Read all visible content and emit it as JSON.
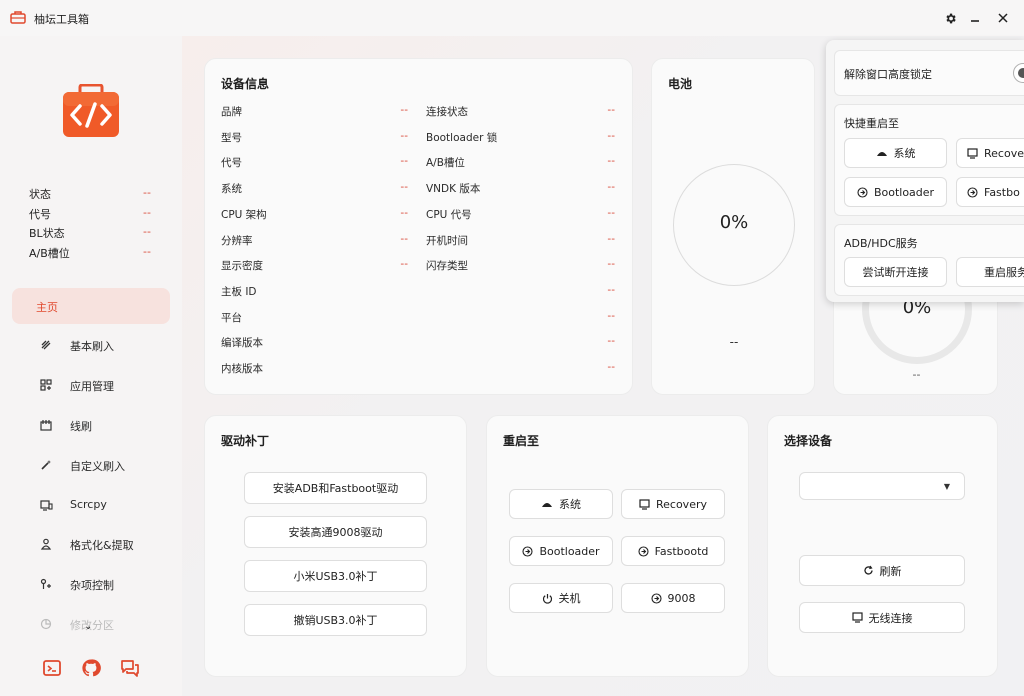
{
  "window": {
    "title": "柚坛工具箱",
    "accent": "#e0492e"
  },
  "sidebar": {
    "status": [
      {
        "label": "状态",
        "value": "--"
      },
      {
        "label": "代号",
        "value": "--"
      },
      {
        "label": "BL状态",
        "value": "--"
      },
      {
        "label": "A/B槽位",
        "value": "--"
      }
    ],
    "nav": [
      {
        "label": "主页",
        "icon": "home-icon"
      },
      {
        "label": "基本刷入",
        "icon": "flash-icon"
      },
      {
        "label": "应用管理",
        "icon": "apps-icon"
      },
      {
        "label": "线刷",
        "icon": "line-flash-icon"
      },
      {
        "label": "自定义刷入",
        "icon": "wand-icon"
      },
      {
        "label": "Scrcpy",
        "icon": "screen-mirror-icon"
      },
      {
        "label": "格式化&提取",
        "icon": "format-icon"
      },
      {
        "label": "杂项控制",
        "icon": "misc-control-icon"
      },
      {
        "label": "修改分区",
        "icon": "partition-icon"
      }
    ]
  },
  "device_info": {
    "title": "设备信息",
    "left": [
      {
        "label": "品牌",
        "value": "--"
      },
      {
        "label": "型号",
        "value": "--"
      },
      {
        "label": "代号",
        "value": "--"
      },
      {
        "label": "系统",
        "value": "--"
      },
      {
        "label": "CPU 架构",
        "value": "--"
      },
      {
        "label": "分辨率",
        "value": "--"
      },
      {
        "label": "显示密度",
        "value": "--"
      },
      {
        "label": "主板 ID",
        "value": "--"
      },
      {
        "label": "平台",
        "value": "--"
      },
      {
        "label": "编译版本",
        "value": "--"
      },
      {
        "label": "内核版本",
        "value": "--"
      }
    ],
    "right": [
      {
        "label": "连接状态",
        "value": "--"
      },
      {
        "label": "Bootloader 锁",
        "value": "--"
      },
      {
        "label": "A/B槽位",
        "value": "--"
      },
      {
        "label": "VNDK 版本",
        "value": "--"
      },
      {
        "label": "CPU 代号",
        "value": "--"
      },
      {
        "label": "开机时间",
        "value": "--"
      },
      {
        "label": "闪存类型",
        "value": "--"
      }
    ]
  },
  "battery": {
    "title": "电池",
    "percent": "0%",
    "level": 0,
    "status": "--"
  },
  "storage": {
    "percent": "0%",
    "status": "--"
  },
  "driver": {
    "title": "驱动补丁",
    "buttons": [
      "安装ADB和Fastboot驱动",
      "安装高通9008驱动",
      "小米USB3.0补丁",
      "撤销USB3.0补丁"
    ]
  },
  "reboot": {
    "title": "重启至",
    "buttons": [
      {
        "label": "系统",
        "icon": "system-icon"
      },
      {
        "label": "Recovery",
        "icon": "recovery-icon"
      },
      {
        "label": "Bootloader",
        "icon": "bootloader-icon"
      },
      {
        "label": "Fastbootd",
        "icon": "fastbootd-icon"
      },
      {
        "label": "关机",
        "icon": "power-icon"
      },
      {
        "label": "9008",
        "icon": "edl-icon"
      }
    ]
  },
  "device_select": {
    "title": "选择设备",
    "selected": "",
    "refresh_label": "刷新",
    "wireless_label": "无线连接"
  },
  "flyout": {
    "lock_label": "解除窗口高度锁定",
    "lock_on": false,
    "quick_reboot_title": "快捷重启至",
    "quick_buttons": [
      {
        "label": "系统",
        "icon": "system-icon"
      },
      {
        "label": "Recove",
        "icon": "recovery-icon"
      },
      {
        "label": "Bootloader",
        "icon": "bootloader-icon"
      },
      {
        "label": "Fastbo",
        "icon": "fastbootd-icon"
      }
    ],
    "adb_title": "ADB/HDC服务",
    "adb_buttons": [
      "尝试断开连接",
      "重启服务"
    ]
  }
}
